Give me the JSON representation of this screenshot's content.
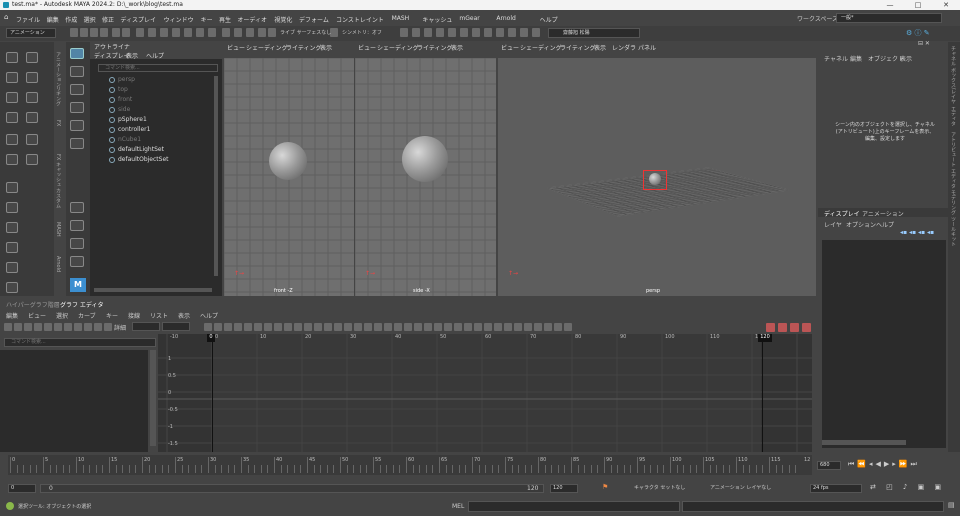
{
  "window": {
    "title": "test.ma* - Autodesk MAYA 2024.2: D:\\_work\\blog\\test.ma",
    "min": "—",
    "max": "□",
    "close": "✕"
  },
  "menu": [
    "ファイル",
    "編集",
    "作成",
    "選択",
    "修正",
    "ディスプレイ",
    "ウィンドウ",
    "キー",
    "再生",
    "オーディオ",
    "視覚化",
    "デフォーム",
    "コンストレイント",
    "MASH",
    "キャッシュ",
    "mGear",
    "Arnold",
    "ヘルプ"
  ],
  "workspace": {
    "label": "ワークスペース：",
    "value": "一般*"
  },
  "shelf": {
    "menuset": "アニメーション",
    "live": "ライブ サーフェスなし",
    "symmetry": "シンメトリ：オフ",
    "login": "齋藤旭 松陽"
  },
  "left_tabs": [
    "アニメーション",
    "リギング",
    "FX",
    "FX キャッシュ",
    "カスタム",
    "MASH",
    "Arnold"
  ],
  "outliner": {
    "title": "アウトライナ",
    "menus": [
      "ディスプレイ",
      "表示",
      "ヘルプ"
    ],
    "search": "コマンド検索...",
    "items": [
      {
        "label": "persp",
        "dim": true
      },
      {
        "label": "top",
        "dim": true
      },
      {
        "label": "front",
        "dim": true
      },
      {
        "label": "side",
        "dim": true
      },
      {
        "label": "pSphere1",
        "dim": false
      },
      {
        "label": "controller1",
        "dim": false
      },
      {
        "label": "nCube1",
        "dim": true
      },
      {
        "label": "defaultLightSet",
        "dim": false
      },
      {
        "label": "defaultObjectSet",
        "dim": false
      }
    ]
  },
  "viewports": [
    {
      "menus": [
        "ビュー",
        "シェーディング",
        "ライティング",
        "表示"
      ],
      "name": "front -Z"
    },
    {
      "menus": [
        "ビュー",
        "シェーディング",
        "ライティング",
        "表示"
      ],
      "name": "side -X"
    },
    {
      "menus": [
        "ビュー",
        "シェーディング",
        "ライティング",
        "表示",
        "レンダラ",
        "パネル"
      ],
      "name": "persp"
    }
  ],
  "channel": {
    "menus": [
      "チャネル",
      "編集",
      "オブジェクト",
      "表示"
    ],
    "message": "シーン内のオブジェクトを選択し、チャネル(アトリビュート)上のキーフレームを表示、編集、設定します",
    "layer_tabs": [
      "ディスプレイ",
      "アニメーション"
    ],
    "layer_menus": [
      "レイヤ",
      "オプション",
      "ヘルプ"
    ]
  },
  "right_tabs": [
    "チャネル ボックス/レイヤ エディタ",
    "アトリビュート エディタ",
    "モデリング ツールキット"
  ],
  "graph": {
    "tabs": [
      "ハイパーグラフ階層",
      "グラフ エディタ"
    ],
    "menus": [
      "編集",
      "ビュー",
      "選択",
      "カーブ",
      "キー",
      "接線",
      "リスト",
      "表示",
      "ヘルプ"
    ],
    "detail": "詳細",
    "search": "コマンド検索...",
    "xticks": [
      "-10",
      "0",
      "10",
      "20",
      "30",
      "40",
      "50",
      "60",
      "70",
      "80",
      "90",
      "100",
      "110",
      "120"
    ],
    "yticks": [
      "1",
      "0.5",
      "0",
      "-0.5",
      "-1",
      "-1.5"
    ],
    "current": "0",
    "end": "120"
  },
  "timeline": {
    "ticks": [
      "0",
      "5",
      "10",
      "15",
      "20",
      "25",
      "30",
      "35",
      "40",
      "45",
      "50",
      "55",
      "60",
      "65",
      "70",
      "75",
      "80",
      "85",
      "90",
      "95",
      "100",
      "105",
      "110",
      "115",
      "12"
    ],
    "frame": "680"
  },
  "range": {
    "start": "0",
    "start2": "0",
    "end2": "120",
    "end": "120",
    "character": "キャラクタ セットなし",
    "animlayer": "アニメーション レイヤなし",
    "fps": "24 fps"
  },
  "cmd": {
    "mel": "MEL",
    "help": "選択ツール: オブジェクトの選択"
  }
}
